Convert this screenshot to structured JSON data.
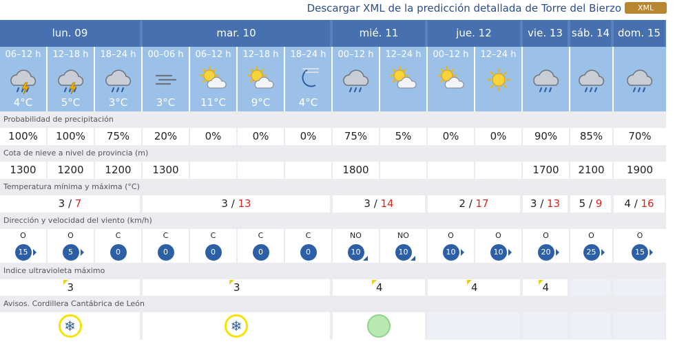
{
  "header": {
    "download_text": "Descargar XML de la predicción detallada de Torre del Bierzo",
    "xml_badge": "XML"
  },
  "days": [
    {
      "label": "lun. 09"
    },
    {
      "label": "mar. 10"
    },
    {
      "label": "mié. 11"
    },
    {
      "label": "jue. 12"
    },
    {
      "label": "vie. 13"
    },
    {
      "label": "sáb. 14"
    },
    {
      "label": "dom. 15"
    }
  ],
  "periods": [
    {
      "label": "06–12 h",
      "temp": "4°C",
      "icon": "storm-rain-icon"
    },
    {
      "label": "12–18 h",
      "temp": "5°C",
      "icon": "storm-rain-icon"
    },
    {
      "label": "18–24 h",
      "temp": "3°C",
      "icon": "rain-cloud-icon"
    },
    {
      "label": "00–06 h",
      "temp": "3°C",
      "icon": "fog-icon"
    },
    {
      "label": "06–12 h",
      "temp": "11°C",
      "icon": "sun-cloud-icon"
    },
    {
      "label": "12–18 h",
      "temp": "9°C",
      "icon": "sun-cloud-icon"
    },
    {
      "label": "18–24 h",
      "temp": "4°C",
      "icon": "moon-fog-icon"
    },
    {
      "label": "00–12 h",
      "temp": "",
      "icon": "rain-cloud-icon"
    },
    {
      "label": "12–24 h",
      "temp": "",
      "icon": "sun-cloud-icon"
    },
    {
      "label": "00–12 h",
      "temp": "",
      "icon": "sun-cloud-icon"
    },
    {
      "label": "12–24 h",
      "temp": "",
      "icon": "sun-icon"
    },
    {
      "label": "",
      "temp": "",
      "icon": "rain-cloud-icon"
    },
    {
      "label": "",
      "temp": "",
      "icon": "rain-cloud-icon"
    },
    {
      "label": "",
      "temp": "",
      "icon": "rain-cloud-icon"
    }
  ],
  "precip": {
    "title": "Probabilidad de precipitación",
    "values": [
      "100%",
      "100%",
      "75%",
      "20%",
      "0%",
      "0%",
      "0%",
      "75%",
      "5%",
      "0%",
      "0%",
      "90%",
      "85%",
      "70%"
    ]
  },
  "snow": {
    "title": "Cota de nieve a nivel de provincia (m)",
    "values": [
      "1300",
      "1200",
      "1200",
      "1300",
      "",
      "",
      "",
      "1800",
      "",
      "",
      "",
      "1700",
      "2100",
      "1900"
    ]
  },
  "temps": {
    "title": "Temperatura mínima y máxima (°C)",
    "sep": " / ",
    "values": [
      {
        "min": "3",
        "max": "7"
      },
      {
        "min": "3",
        "max": "13"
      },
      {
        "min": "3",
        "max": "14"
      },
      {
        "min": "2",
        "max": "17"
      },
      {
        "min": "3",
        "max": "13"
      },
      {
        "min": "5",
        "max": "9"
      },
      {
        "min": "4",
        "max": "16"
      }
    ]
  },
  "wind": {
    "title": "Dirección y velocidad del viento (km/h)",
    "values": [
      {
        "dir": "O",
        "speed": "15",
        "arrow": "r"
      },
      {
        "dir": "O",
        "speed": "5",
        "arrow": "r"
      },
      {
        "dir": "C",
        "speed": "0",
        "arrow": ""
      },
      {
        "dir": "C",
        "speed": "0",
        "arrow": ""
      },
      {
        "dir": "C",
        "speed": "0",
        "arrow": ""
      },
      {
        "dir": "C",
        "speed": "0",
        "arrow": ""
      },
      {
        "dir": "C",
        "speed": "0",
        "arrow": ""
      },
      {
        "dir": "NO",
        "speed": "10",
        "arrow": "se"
      },
      {
        "dir": "NO",
        "speed": "10",
        "arrow": "se"
      },
      {
        "dir": "O",
        "speed": "10",
        "arrow": "r"
      },
      {
        "dir": "O",
        "speed": "10",
        "arrow": "r"
      },
      {
        "dir": "O",
        "speed": "20",
        "arrow": "r"
      },
      {
        "dir": "O",
        "speed": "25",
        "arrow": "r"
      },
      {
        "dir": "O",
        "speed": "15",
        "arrow": "r"
      }
    ]
  },
  "uv": {
    "title": "Indice ultravioleta máximo",
    "values": [
      "3",
      "3",
      "4",
      "4",
      "4",
      "",
      ""
    ]
  },
  "warnings": {
    "title": "Avisos. Cordillera Cantábrica de León",
    "values": [
      {
        "type": "snow",
        "symbol": "❄"
      },
      {
        "type": "snow",
        "symbol": "❄"
      },
      {
        "type": "green",
        "symbol": ""
      },
      {
        "type": "empty",
        "symbol": ""
      },
      {
        "type": "empty",
        "symbol": ""
      },
      {
        "type": "empty",
        "symbol": ""
      },
      {
        "type": "empty",
        "symbol": ""
      }
    ]
  },
  "colors": {
    "header_blue": "#4670b0",
    "period_blue": "#9cc1e8",
    "label_gray": "#ececf0",
    "wind_blue": "#2d5fa6",
    "max_red": "#d9261c",
    "uv_yellow": "#e8d21a"
  }
}
